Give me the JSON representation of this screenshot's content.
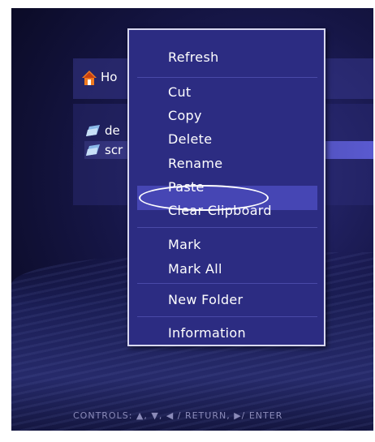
{
  "header": {
    "title": "Ho",
    "icon": "home-icon"
  },
  "files": [
    {
      "name": "de",
      "icon": "folder-icon",
      "selected": false
    },
    {
      "name": "scr",
      "icon": "folder-icon",
      "selected": true
    }
  ],
  "menu": {
    "items": [
      {
        "label": "Refresh"
      },
      {
        "label": "Cut"
      },
      {
        "label": "Copy"
      },
      {
        "label": "Delete"
      },
      {
        "label": "Rename"
      },
      {
        "label": "Paste",
        "highlighted": true,
        "circled": true
      },
      {
        "label": "Clear Clipboard"
      },
      {
        "label": "Mark"
      },
      {
        "label": "Mark All"
      },
      {
        "label": "New Folder"
      },
      {
        "label": "Information"
      }
    ]
  },
  "footer": {
    "controls": "CONTROLS:  ▲, ▼, ◀ / RETURN,  ▶/ ENTER"
  },
  "colors": {
    "menu_bg": "#2c2c82",
    "highlight": "#4646b4",
    "selected_row": "#5a5ad0"
  }
}
